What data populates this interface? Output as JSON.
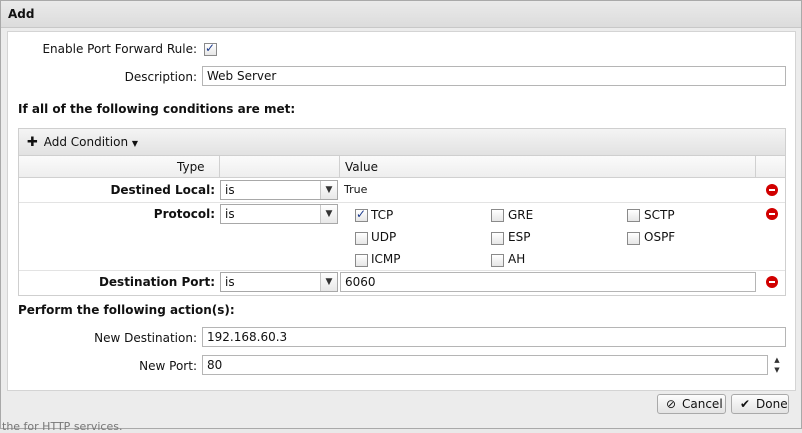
{
  "dialog": {
    "title": "Add"
  },
  "form": {
    "enable_label": "Enable Port Forward Rule:",
    "enable_checked": true,
    "description_label": "Description:",
    "description_value": "Web Server"
  },
  "conditions": {
    "heading": "If all of the following conditions are met:",
    "add_button": "Add Condition",
    "col_type": "Type",
    "col_value": "Value",
    "rows": [
      {
        "label": "Destined Local:",
        "operator": "is",
        "value": "True"
      },
      {
        "label": "Protocol:",
        "operator": "is",
        "protocols": [
          {
            "name": "TCP",
            "checked": true
          },
          {
            "name": "GRE",
            "checked": false
          },
          {
            "name": "SCTP",
            "checked": false
          },
          {
            "name": "UDP",
            "checked": false
          },
          {
            "name": "ESP",
            "checked": false
          },
          {
            "name": "OSPF",
            "checked": false
          },
          {
            "name": "ICMP",
            "checked": false
          },
          {
            "name": "AH",
            "checked": false
          }
        ]
      },
      {
        "label": "Destination Port:",
        "operator": "is",
        "value": "6060"
      }
    ]
  },
  "actions": {
    "heading": "Perform the following action(s):",
    "new_destination_label": "New Destination:",
    "new_destination_value": "192.168.60.3",
    "new_port_label": "New Port:",
    "new_port_value": "80"
  },
  "buttons": {
    "cancel": "Cancel",
    "done": "Done"
  },
  "background_text": "the for HTTP services."
}
